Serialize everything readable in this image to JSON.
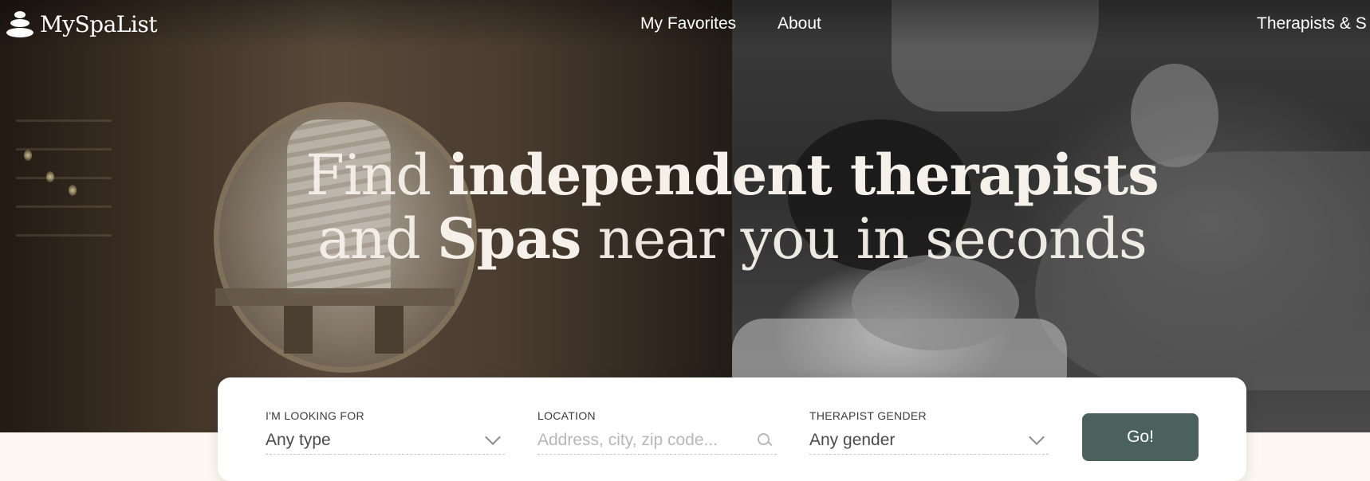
{
  "header": {
    "brand": "MySpaList",
    "nav": [
      {
        "label": "My Favorites"
      },
      {
        "label": "About"
      },
      {
        "label": "Therapists & S"
      }
    ]
  },
  "hero": {
    "line1": {
      "light": "Find",
      "bold": "independent therapists"
    },
    "line2": {
      "light1": "and",
      "bold": "Spas",
      "light2": "near you in seconds"
    }
  },
  "search": {
    "type": {
      "label": "I'M LOOKING FOR",
      "value": "Any type"
    },
    "location": {
      "label": "LOCATION",
      "placeholder": "Address, city, zip code..."
    },
    "gender": {
      "label": "THERAPIST GENDER",
      "value": "Any gender"
    },
    "go_label": "Go!"
  },
  "colors": {
    "accent": "#4b625c",
    "page_background": "#fdf8f2",
    "headline": "#f5f1ea"
  },
  "icons": [
    "stone-stack-logo-icon",
    "chevron-down-icon",
    "search-icon"
  ]
}
